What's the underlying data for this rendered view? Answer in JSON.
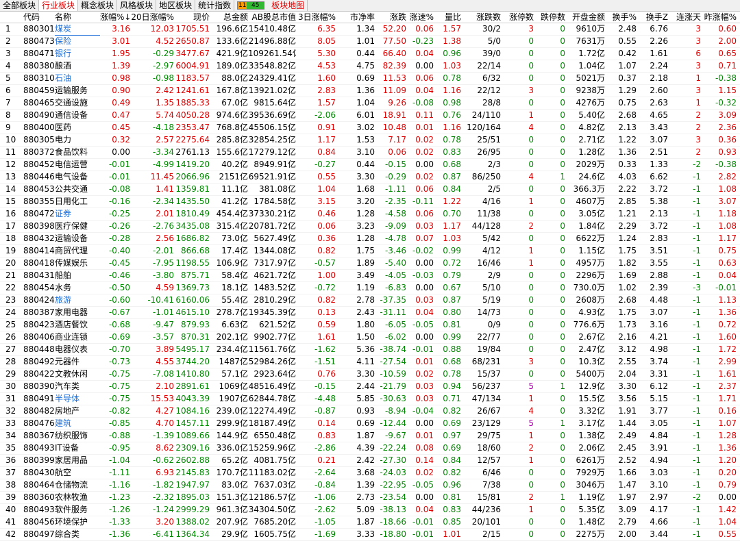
{
  "tabs": [
    {
      "label": "全部板块",
      "state": ""
    },
    {
      "label": "行业板块",
      "state": "active"
    },
    {
      "label": "概念板块",
      "state": ""
    },
    {
      "label": "风格板块",
      "state": ""
    },
    {
      "label": "地区板块",
      "state": ""
    },
    {
      "label": "统计指数",
      "state": ""
    },
    {
      "label": "板块地图",
      "state": "red"
    }
  ],
  "advance_decline": {
    "up": "11",
    "down": "45"
  },
  "columns": [
    "",
    "代码",
    "名称",
    "涨幅%↓",
    "20日涨幅%",
    "现价",
    "总金额",
    "AB股总市值",
    "3日涨幅%",
    "市净率",
    "涨跌",
    "涨速%",
    "量比",
    "涨跌数",
    "涨停数",
    "跌停数",
    "开盘金额",
    "换手%",
    "换手Z",
    "连涨天",
    "昨涨幅%"
  ],
  "rows": [
    [
      "1",
      "880301",
      "煤炭",
      "3.16",
      "12.03",
      "1705.51",
      "196.6亿",
      "15410.48亿",
      "6.35",
      "1.34",
      "52.20",
      "0.06",
      "1.57",
      "30/2",
      "3",
      "0",
      "9610万",
      "2.48",
      "6.76",
      "3",
      "0.60"
    ],
    [
      "2",
      "880473",
      "保险",
      "3.01",
      "4.52",
      "2650.87",
      "133.6亿",
      "21496.88亿",
      "8.05",
      "1.01",
      "77.50",
      "-0.23",
      "1.38",
      "5/0",
      "0",
      "0",
      "7631万",
      "0.55",
      "2.26",
      "3",
      "2.00"
    ],
    [
      "3",
      "880471",
      "银行",
      "1.95",
      "-0.29",
      "3477.67",
      "421.9亿",
      "109261.54亿",
      "5.30",
      "0.44",
      "66.40",
      "0.04",
      "0.96",
      "39/0",
      "0",
      "0",
      "1.72亿",
      "0.42",
      "1.61",
      "6",
      "0.65"
    ],
    [
      "4",
      "880380",
      "酿酒",
      "1.39",
      "-2.97",
      "6004.91",
      "189.0亿",
      "33548.82亿",
      "4.53",
      "4.75",
      "82.39",
      "0.00",
      "1.03",
      "22/14",
      "0",
      "0",
      "1.04亿",
      "1.07",
      "2.24",
      "3",
      "0.71"
    ],
    [
      "5",
      "880310",
      "石油",
      "0.98",
      "-0.98",
      "1183.57",
      "88.0亿",
      "24329.41亿",
      "1.60",
      "0.69",
      "11.53",
      "0.06",
      "0.78",
      "6/32",
      "0",
      "0",
      "5021万",
      "0.37",
      "2.18",
      "1",
      "-0.38"
    ],
    [
      "6",
      "880459",
      "运输服务",
      "0.90",
      "2.42",
      "1241.61",
      "167.8亿",
      "13921.02亿",
      "2.83",
      "1.36",
      "11.09",
      "0.04",
      "1.16",
      "22/12",
      "3",
      "0",
      "9238万",
      "1.29",
      "2.60",
      "3",
      "1.15"
    ],
    [
      "7",
      "880465",
      "交通设施",
      "0.49",
      "1.35",
      "1885.33",
      "67.0亿",
      "9815.64亿",
      "1.57",
      "1.04",
      "9.26",
      "-0.08",
      "0.98",
      "28/8",
      "0",
      "0",
      "4276万",
      "0.75",
      "2.63",
      "1",
      "-0.32"
    ],
    [
      "8",
      "880490",
      "通信设备",
      "0.47",
      "5.74",
      "4050.28",
      "974.6亿",
      "39536.69亿",
      "-2.06",
      "6.01",
      "18.91",
      "0.11",
      "0.76",
      "24/110",
      "1",
      "0",
      "5.40亿",
      "2.68",
      "4.65",
      "2",
      "3.09"
    ],
    [
      "9",
      "880400",
      "医药",
      "0.45",
      "-4.18",
      "2353.47",
      "768.8亿",
      "45506.15亿",
      "0.91",
      "3.02",
      "10.48",
      "0.01",
      "1.16",
      "120/164",
      "4",
      "0",
      "4.82亿",
      "2.13",
      "3.43",
      "2",
      "2.36"
    ],
    [
      "10",
      "880305",
      "电力",
      "0.32",
      "2.57",
      "2275.64",
      "285.8亿",
      "32854.25亿",
      "1.17",
      "1.53",
      "7.17",
      "0.02",
      "0.78",
      "25/51",
      "0",
      "0",
      "2.71亿",
      "1.22",
      "3.07",
      "3",
      "0.36"
    ],
    [
      "11",
      "880372",
      "食品饮料",
      "0.00",
      "-3.34",
      "2761.13",
      "155.6亿",
      "17279.12亿",
      "0.84",
      "3.10",
      "0.06",
      "0.02",
      "0.83",
      "26/95",
      "0",
      "0",
      "1.28亿",
      "1.36",
      "2.51",
      "2",
      "0.93"
    ],
    [
      "12",
      "880452",
      "电信运营",
      "-0.01",
      "-4.99",
      "1419.20",
      "40.2亿",
      "8949.91亿",
      "-0.27",
      "0.44",
      "-0.15",
      "0.00",
      "0.68",
      "2/3",
      "0",
      "0",
      "2029万",
      "0.33",
      "1.33",
      "-2",
      "-0.38"
    ],
    [
      "13",
      "880446",
      "电气设备",
      "-0.01",
      "11.45",
      "2066.96",
      "2151亿",
      "69521.91亿",
      "0.55",
      "3.30",
      "-0.29",
      "0.02",
      "0.87",
      "86/250",
      "4",
      "1",
      "24.6亿",
      "4.03",
      "6.62",
      "-1",
      "2.82"
    ],
    [
      "14",
      "880453",
      "公共交通",
      "-0.08",
      "1.41",
      "1359.81",
      "11.1亿",
      "381.08亿",
      "1.04",
      "1.68",
      "-1.11",
      "0.06",
      "0.84",
      "2/5",
      "0",
      "0",
      "366.3万",
      "2.22",
      "3.72",
      "-1",
      "1.08"
    ],
    [
      "15",
      "880355",
      "日用化工",
      "-0.16",
      "-2.34",
      "1435.50",
      "41.2亿",
      "1784.58亿",
      "3.15",
      "3.20",
      "-2.35",
      "-0.11",
      "1.22",
      "4/16",
      "1",
      "0",
      "4607万",
      "2.85",
      "5.38",
      "-1",
      "3.07"
    ],
    [
      "16",
      "880472",
      "证券",
      "-0.25",
      "2.01",
      "1810.49",
      "454.4亿",
      "37330.21亿",
      "0.46",
      "1.28",
      "-4.58",
      "0.06",
      "0.70",
      "11/38",
      "0",
      "0",
      "3.05亿",
      "1.21",
      "2.13",
      "-1",
      "1.18"
    ],
    [
      "17",
      "880398",
      "医疗保健",
      "-0.26",
      "-2.76",
      "3435.08",
      "315.4亿",
      "20781.72亿",
      "0.06",
      "3.23",
      "-9.09",
      "0.03",
      "1.17",
      "44/128",
      "2",
      "0",
      "1.84亿",
      "2.29",
      "3.72",
      "-1",
      "1.08"
    ],
    [
      "18",
      "880432",
      "运输设备",
      "-0.28",
      "2.56",
      "1686.82",
      "73.0亿",
      "5627.49亿",
      "0.36",
      "1.28",
      "-4.78",
      "0.07",
      "1.03",
      "5/42",
      "0",
      "0",
      "6622万",
      "1.24",
      "2.83",
      "-1",
      "1.17"
    ],
    [
      "19",
      "880414",
      "商贸代理",
      "-0.40",
      "-2.01",
      "866.68",
      "17.4亿",
      "1344.08亿",
      "0.82",
      "1.75",
      "-3.46",
      "-0.02",
      "0.99",
      "4/12",
      "1",
      "0",
      "1.15亿",
      "1.75",
      "3.51",
      "-1",
      "0.75"
    ],
    [
      "20",
      "880418",
      "传媒娱乐",
      "-0.45",
      "-7.95",
      "1198.55",
      "106.9亿",
      "7317.97亿",
      "-0.57",
      "1.89",
      "-5.40",
      "0.00",
      "0.72",
      "16/46",
      "1",
      "0",
      "4957万",
      "1.82",
      "3.55",
      "-1",
      "0.63"
    ],
    [
      "21",
      "880431",
      "船舶",
      "-0.46",
      "-3.80",
      "875.71",
      "58.4亿",
      "4621.72亿",
      "1.00",
      "3.49",
      "-4.05",
      "-0.03",
      "0.79",
      "2/9",
      "0",
      "0",
      "2296万",
      "1.69",
      "2.88",
      "-1",
      "0.04"
    ],
    [
      "22",
      "880454",
      "水务",
      "-0.50",
      "4.59",
      "1369.73",
      "18.1亿",
      "1483.52亿",
      "-0.72",
      "1.19",
      "-6.83",
      "0.00",
      "0.67",
      "5/10",
      "0",
      "0",
      "730.0万",
      "1.02",
      "2.39",
      "-3",
      "-0.01"
    ],
    [
      "23",
      "880424",
      "旅游",
      "-0.60",
      "-10.41",
      "6160.06",
      "55.4亿",
      "2810.29亿",
      "0.82",
      "2.78",
      "-37.35",
      "0.03",
      "0.87",
      "5/19",
      "0",
      "0",
      "2608万",
      "2.68",
      "4.48",
      "-1",
      "1.13"
    ],
    [
      "24",
      "880387",
      "家用电器",
      "-0.67",
      "-1.01",
      "4615.10",
      "278.7亿",
      "19345.39亿",
      "0.13",
      "2.43",
      "-31.11",
      "0.04",
      "0.80",
      "14/73",
      "0",
      "0",
      "4.93亿",
      "1.75",
      "3.07",
      "-1",
      "1.36"
    ],
    [
      "25",
      "880423",
      "酒店餐饮",
      "-0.68",
      "-9.47",
      "879.93",
      "6.63亿",
      "621.52亿",
      "0.59",
      "1.80",
      "-6.05",
      "-0.05",
      "0.81",
      "0/9",
      "0",
      "0",
      "776.6万",
      "1.73",
      "3.16",
      "-1",
      "0.72"
    ],
    [
      "26",
      "880406",
      "商业连锁",
      "-0.69",
      "-3.57",
      "870.31",
      "202.1亿",
      "9902.77亿",
      "1.61",
      "1.50",
      "-6.02",
      "0.00",
      "0.99",
      "22/77",
      "0",
      "0",
      "2.67亿",
      "2.16",
      "4.21",
      "-1",
      "1.60"
    ],
    [
      "27",
      "880448",
      "电器仪表",
      "-0.70",
      "3.89",
      "5495.17",
      "234.4亿",
      "11561.76亿",
      "-1.62",
      "5.36",
      "-38.74",
      "-0.01",
      "0.88",
      "19/84",
      "0",
      "0",
      "2.47亿",
      "3.12",
      "4.98",
      "-1",
      "1.72"
    ],
    [
      "28",
      "880492",
      "元器件",
      "-0.73",
      "4.55",
      "3744.20",
      "1487亿",
      "52984.26亿",
      "-1.51",
      "4.11",
      "-27.54",
      "0.01",
      "0.68",
      "68/231",
      "3",
      "0",
      "10.3亿",
      "2.55",
      "3.74",
      "-1",
      "2.99"
    ],
    [
      "29",
      "880422",
      "文教休闲",
      "-0.75",
      "-7.08",
      "1410.80",
      "57.1亿",
      "2923.64亿",
      "0.76",
      "3.30",
      "-10.59",
      "0.02",
      "0.78",
      "15/37",
      "0",
      "0",
      "5400万",
      "2.04",
      "3.31",
      "-1",
      "1.61"
    ],
    [
      "30",
      "880390",
      "汽车类",
      "-0.75",
      "2.10",
      "2891.61",
      "1069亿",
      "48516.49亿",
      "-0.15",
      "2.44",
      "-21.79",
      "0.03",
      "0.94",
      "56/237",
      "5",
      "1",
      "12.9亿",
      "3.30",
      "6.12",
      "-1",
      "2.37"
    ],
    [
      "31",
      "880491",
      "半导体",
      "-0.75",
      "15.53",
      "4043.39",
      "1907亿",
      "62844.78亿",
      "-4.48",
      "5.85",
      "-30.63",
      "0.03",
      "0.71",
      "47/134",
      "1",
      "0",
      "15.5亿",
      "3.56",
      "5.15",
      "-1",
      "1.71"
    ],
    [
      "32",
      "880482",
      "房地产",
      "-0.82",
      "4.27",
      "1084.16",
      "239.0亿",
      "12274.49亿",
      "-0.87",
      "0.93",
      "-8.94",
      "-0.04",
      "0.82",
      "26/67",
      "4",
      "0",
      "3.32亿",
      "1.91",
      "3.77",
      "-1",
      "0.16"
    ],
    [
      "33",
      "880476",
      "建筑",
      "-0.85",
      "4.70",
      "1457.11",
      "299.9亿",
      "18187.49亿",
      "0.14",
      "0.69",
      "-12.44",
      "0.00",
      "0.69",
      "23/129",
      "5",
      "1",
      "3.17亿",
      "1.44",
      "3.05",
      "-1",
      "1.07"
    ],
    [
      "34",
      "880367",
      "纺织服饰",
      "-0.88",
      "-1.39",
      "1089.66",
      "144.9亿",
      "6550.48亿",
      "0.83",
      "1.87",
      "-9.67",
      "0.01",
      "0.97",
      "29/75",
      "1",
      "0",
      "1.38亿",
      "2.49",
      "4.84",
      "-1",
      "1.28"
    ],
    [
      "35",
      "880493",
      "IT设备",
      "-0.95",
      "8.62",
      "2309.16",
      "336.0亿",
      "15259.96亿",
      "-2.86",
      "4.39",
      "-22.24",
      "0.08",
      "0.69",
      "18/60",
      "2",
      "0",
      "2.06亿",
      "2.45",
      "3.91",
      "-1",
      "1.36"
    ],
    [
      "36",
      "880399",
      "家居用品",
      "-1.04",
      "-0.62",
      "2602.88",
      "65.2亿",
      "4081.75亿",
      "0.21",
      "2.42",
      "-27.30",
      "0.14",
      "0.84",
      "12/57",
      "1",
      "0",
      "6261万",
      "2.52",
      "4.94",
      "-1",
      "1.20"
    ],
    [
      "37",
      "880430",
      "航空",
      "-1.11",
      "6.93",
      "2145.83",
      "170.7亿",
      "11183.02亿",
      "-2.64",
      "3.68",
      "-24.03",
      "0.02",
      "0.82",
      "6/46",
      "0",
      "0",
      "7929万",
      "1.66",
      "3.03",
      "-1",
      "0.20"
    ],
    [
      "38",
      "880464",
      "仓储物流",
      "-1.16",
      "-1.82",
      "1947.97",
      "83.0亿",
      "7637.03亿",
      "-0.84",
      "1.39",
      "-22.95",
      "-0.05",
      "0.96",
      "7/38",
      "0",
      "0",
      "3046万",
      "1.47",
      "3.10",
      "-1",
      "0.79"
    ],
    [
      "39",
      "880360",
      "农林牧渔",
      "-1.23",
      "-2.32",
      "1895.03",
      "151.3亿",
      "12186.57亿",
      "-1.06",
      "2.73",
      "-23.54",
      "0.00",
      "0.81",
      "15/81",
      "2",
      "1",
      "1.19亿",
      "1.97",
      "2.97",
      "-2",
      "0.00"
    ],
    [
      "40",
      "880493",
      "软件服务",
      "-1.26",
      "-1.24",
      "2999.29",
      "961.3亿",
      "34304.50亿",
      "-2.62",
      "5.09",
      "-38.13",
      "0.04",
      "0.83",
      "44/236",
      "1",
      "0",
      "5.35亿",
      "3.09",
      "4.17",
      "-1",
      "1.42"
    ],
    [
      "41",
      "880456",
      "环境保护",
      "-1.33",
      "3.20",
      "1388.02",
      "207.9亿",
      "7685.20亿",
      "-1.05",
      "1.87",
      "-18.66",
      "-0.01",
      "0.85",
      "20/101",
      "0",
      "0",
      "1.48亿",
      "2.79",
      "4.66",
      "-1",
      "1.04"
    ],
    [
      "42",
      "880497",
      "综合类",
      "-1.36",
      "-6.41",
      "1364.34",
      "29.9亿",
      "1605.75亿",
      "-1.69",
      "3.33",
      "-18.80",
      "-0.01",
      "1.01",
      "2/15",
      "0",
      "0",
      "2275万",
      "2.00",
      "3.44",
      "-1",
      "0.55"
    ]
  ],
  "blue_names": [
    "煤炭",
    "保险",
    "银行",
    "石油",
    "证券",
    "旅游",
    "半导体",
    "建筑"
  ],
  "colors": {
    "up": "#e00000",
    "down": "#008800",
    "flat": "#000000",
    "highlight_name": "#1e6fd9",
    "limit_up_count": "#b000b0"
  }
}
